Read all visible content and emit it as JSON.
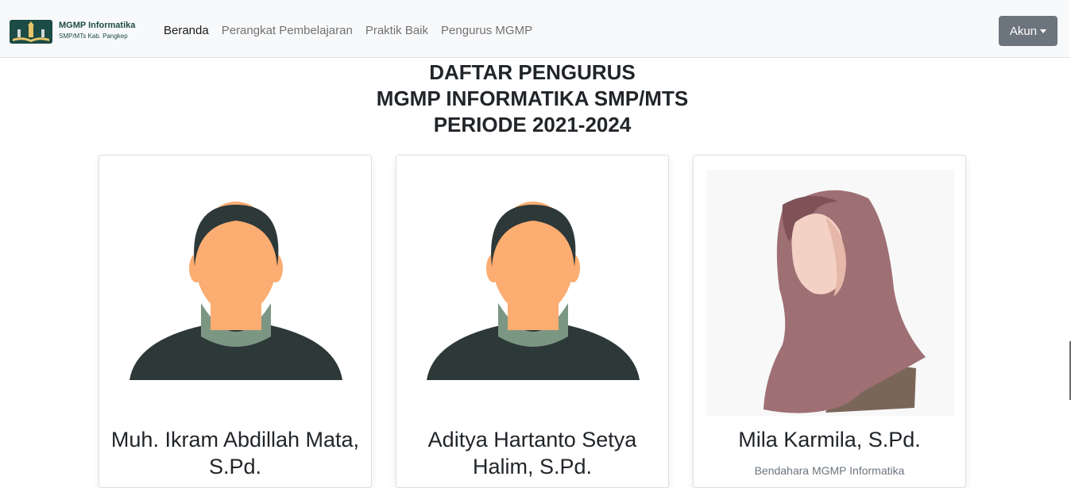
{
  "brand": {
    "title": "MGMP Informatika",
    "subtitle": "SMP/MTs Kab. Pangkep"
  },
  "nav": {
    "items": [
      {
        "label": "Beranda"
      },
      {
        "label": "Perangkat Pembelajaran"
      },
      {
        "label": "Praktik Baik"
      },
      {
        "label": "Pengurus MGMP"
      }
    ],
    "account_label": "Akun"
  },
  "heading": {
    "line1": "DAFTAR PENGURUS",
    "line2": "MGMP INFORMATIKA SMP/MTS",
    "line3": "PERIODE 2021-2024"
  },
  "members": [
    {
      "name": "Muh. Ikram Abdillah Mata, S.Pd.",
      "role": "",
      "avatar": "male-avatar-icon"
    },
    {
      "name": "Aditya Hartanto Setya Halim, S.Pd.",
      "role": "",
      "avatar": "male-avatar-icon"
    },
    {
      "name": "Mila Karmila, S.Pd.",
      "role": "Bendahara MGMP Informatika",
      "avatar": "hijab-female-avatar-icon"
    }
  ],
  "colors": {
    "navbar_bg": "#f8f9fa",
    "account_button": "#6c757d",
    "brand_text": "#1d4b45",
    "skin": "#fbad72",
    "hair": "#2d3838",
    "shirt": "#2d3838",
    "collar": "#7b9783",
    "hijab": "#9e6f73"
  }
}
